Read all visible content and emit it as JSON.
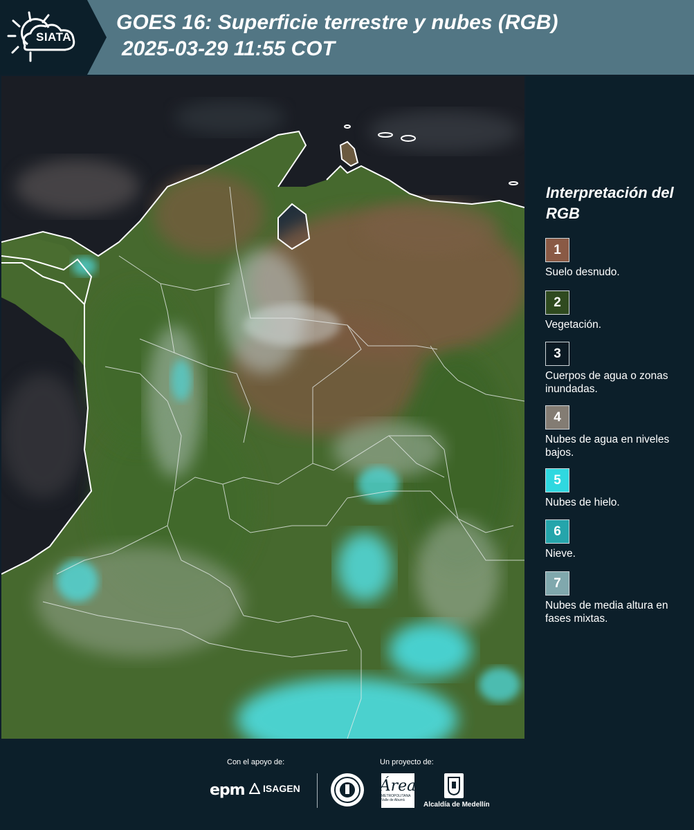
{
  "header": {
    "logo_text": "SIATA",
    "title": "GOES 16: Superficie terrestre y nubes (RGB)",
    "subtitle": "2025-03-29 11:55 COT"
  },
  "legend": {
    "title": "Interpretación del RGB",
    "items": [
      {
        "number": "1",
        "label": "Suelo desnudo.",
        "color": "#8a5a45"
      },
      {
        "number": "2",
        "label": "Vegetación.",
        "color": "#2f4a1f"
      },
      {
        "number": "3",
        "label": "Cuerpos de agua o zonas inundadas.",
        "color": "#0b1a24"
      },
      {
        "number": "4",
        "label": "Nubes de agua en niveles bajos.",
        "color": "#837c73"
      },
      {
        "number": "5",
        "label": "Nubes de hielo.",
        "color": "#2fd8e0"
      },
      {
        "number": "6",
        "label": "Nieve.",
        "color": "#25a5ab"
      },
      {
        "number": "7",
        "label": "Nubes de media altura en fases mixtas.",
        "color": "#80a8ad"
      }
    ]
  },
  "footer": {
    "support_label": "Con el apoyo de:",
    "project_label": "Un proyecto de:",
    "sponsor_1": "epm",
    "sponsor_2": "ISAGEN",
    "partner_1_mark": "Área",
    "partner_1_sub": "METROPOLITANA Valle de Aburrá",
    "partner_2": "Alcaldía de Medellín"
  },
  "colors": {
    "header_bg": "#527684",
    "panel_bg": "#0c1f2a",
    "ocean": "#1a1d24",
    "vegetation": "#3e6a2c",
    "bare_soil": "#7b5a40",
    "ice_cloud": "#44e3ea"
  }
}
